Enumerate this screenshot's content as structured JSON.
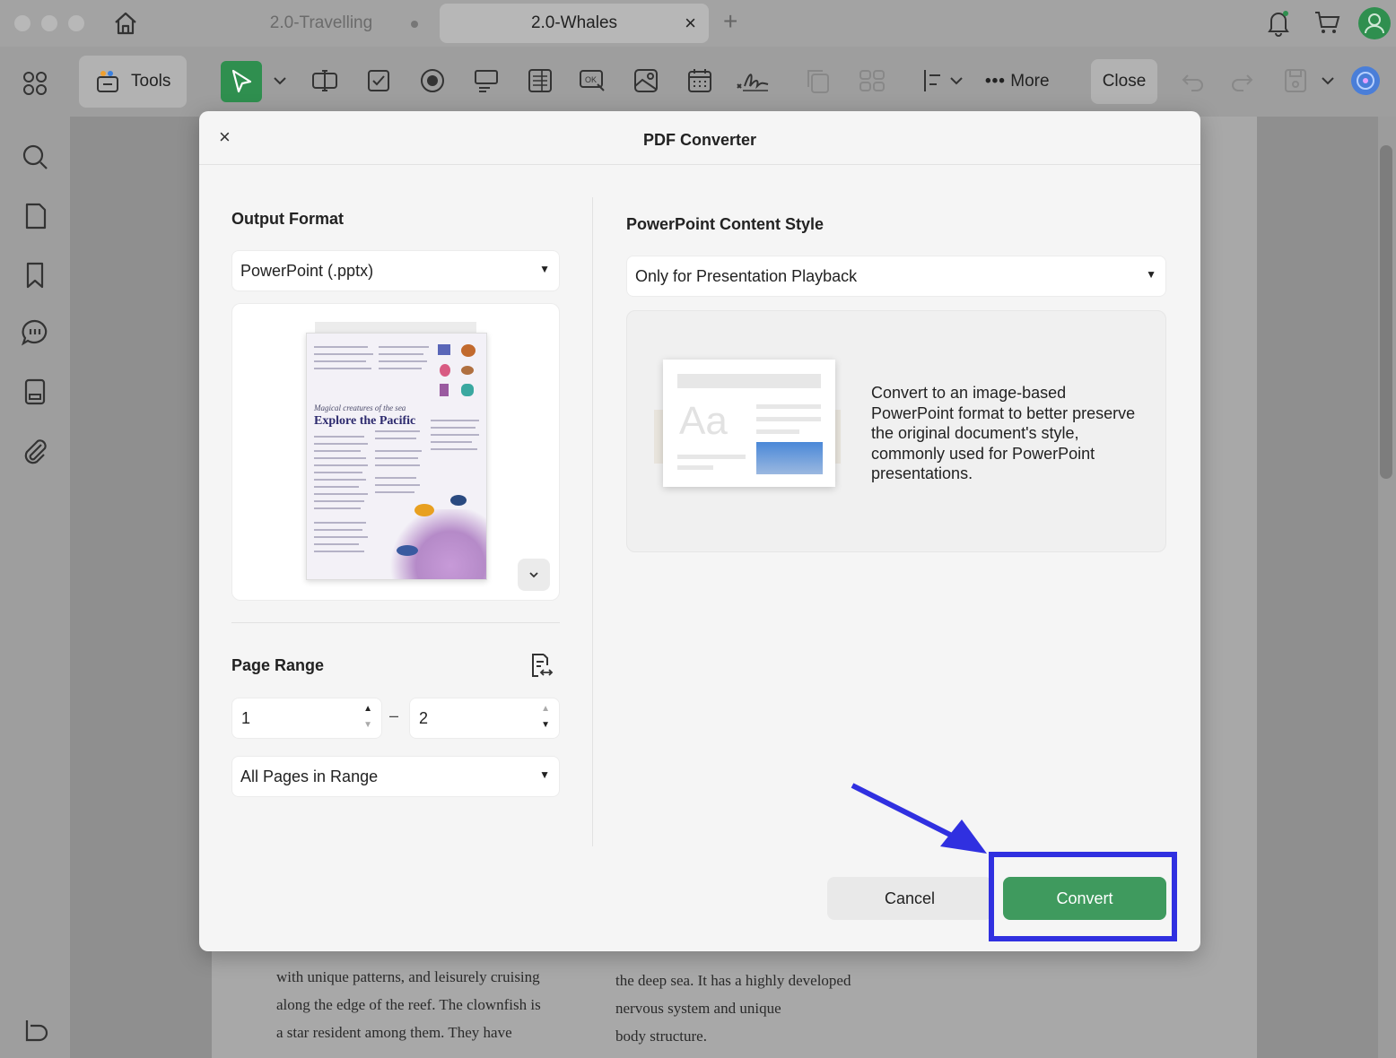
{
  "tabs": [
    {
      "label": "2.0-Travelling",
      "active": false
    },
    {
      "label": "2.0-Whales",
      "active": true
    }
  ],
  "toolbar": {
    "tools_label": "Tools",
    "more_label": "More",
    "close_label": "Close"
  },
  "document_text": {
    "left_lines": [
      "with unique patterns, and leisurely cruising",
      "along the edge of the reef. The clownfish is",
      "a star resident among them. They have"
    ],
    "right_lines": [
      "the deep sea. It has a highly developed",
      "nervous system and unique",
      "body structure."
    ]
  },
  "dialog": {
    "title": "PDF Converter",
    "output_format_label": "Output Format",
    "output_format_value": "PowerPoint (.pptx)",
    "preview": {
      "subtitle": "Magical creatures of the sea",
      "title": "Explore the Pacific"
    },
    "page_range_label": "Page Range",
    "range_from": "1",
    "range_separator": "–",
    "range_to": "2",
    "range_mode": "All Pages in Range",
    "content_style_label": "PowerPoint Content Style",
    "content_style_value": "Only for Presentation Playback",
    "content_style_description": "Convert to an image-based PowerPoint format to better preserve the original document's style, commonly used for PowerPoint presentations.",
    "slide_sample_text": "Aa",
    "cancel_label": "Cancel",
    "convert_label": "Convert"
  },
  "colors": {
    "accent_green": "#3f9a5e",
    "highlight_blue": "#3030e0"
  }
}
